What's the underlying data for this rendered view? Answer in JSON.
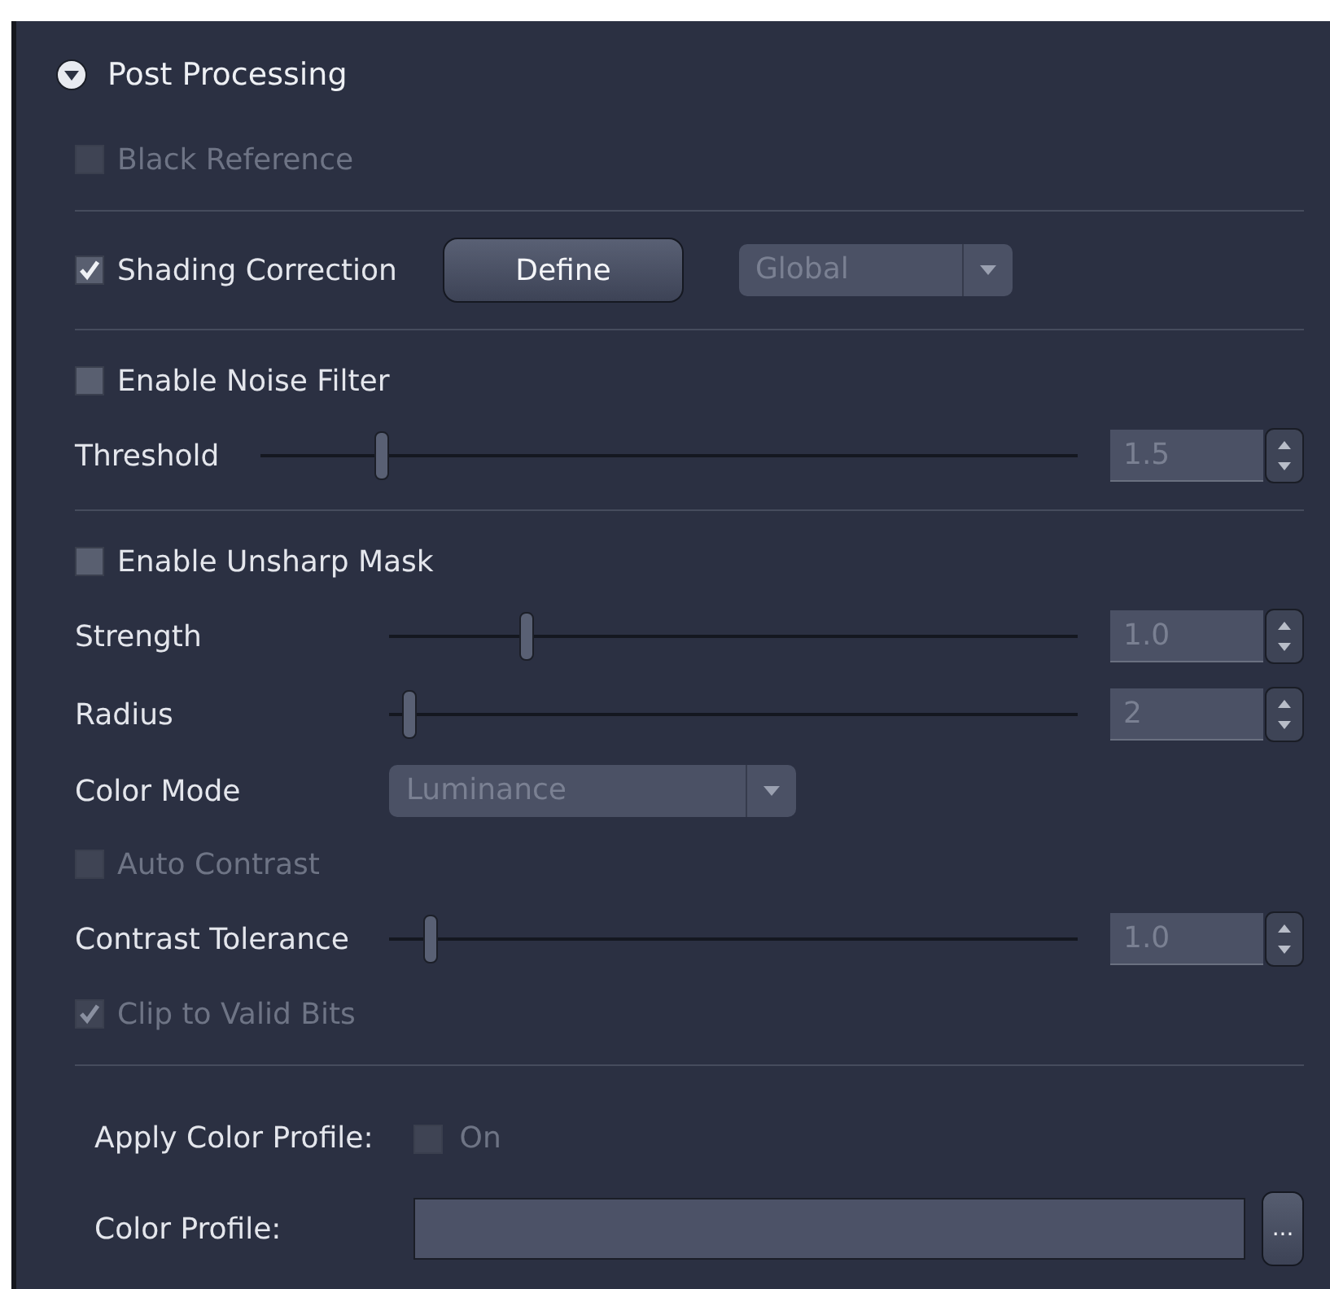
{
  "header": {
    "title": "Post Processing",
    "expanded": true
  },
  "sections": [
    {
      "rows": [
        {
          "kind": "checkbox",
          "label": "Black Reference",
          "checked": false,
          "disabled": true
        }
      ]
    },
    {
      "rows": [
        {
          "kind": "checkbox",
          "label": "Shading Correction",
          "checked": true,
          "disabled": false,
          "button": "Define",
          "dropdown": {
            "value": "Global",
            "disabled": true
          }
        }
      ]
    },
    {
      "rows": [
        {
          "kind": "checkbox",
          "label": "Enable Noise Filter",
          "checked": false,
          "disabled": false
        },
        {
          "kind": "slider",
          "label": "Threshold",
          "level": 0.15,
          "value": "1.5"
        }
      ]
    },
    {
      "rows": [
        {
          "kind": "checkbox",
          "label": "Enable Unsharp Mask",
          "checked": false,
          "disabled": false
        },
        {
          "kind": "slider",
          "label": "Strength",
          "level": 0.2,
          "value": "1.0"
        },
        {
          "kind": "slider",
          "label": "Radius",
          "level": 0.03,
          "value": "2"
        },
        {
          "kind": "dropdown",
          "label": "Color Mode",
          "value": "Luminance",
          "disabled": true
        },
        {
          "kind": "checkbox",
          "label": "Auto Contrast",
          "checked": false,
          "disabled": true
        },
        {
          "kind": "slider",
          "label": "Contrast Tolerance",
          "level": 0.06,
          "value": "1.0"
        },
        {
          "kind": "checkbox",
          "label": "Clip to Valid Bits",
          "checked": true,
          "disabled": true
        }
      ]
    },
    {
      "rows": [
        {
          "kind": "toggle",
          "label": "Apply Color Profile:",
          "option": "On",
          "checked": false,
          "disabled": true
        },
        {
          "kind": "file",
          "label": "Color Profile:",
          "button": "..."
        }
      ]
    }
  ]
}
